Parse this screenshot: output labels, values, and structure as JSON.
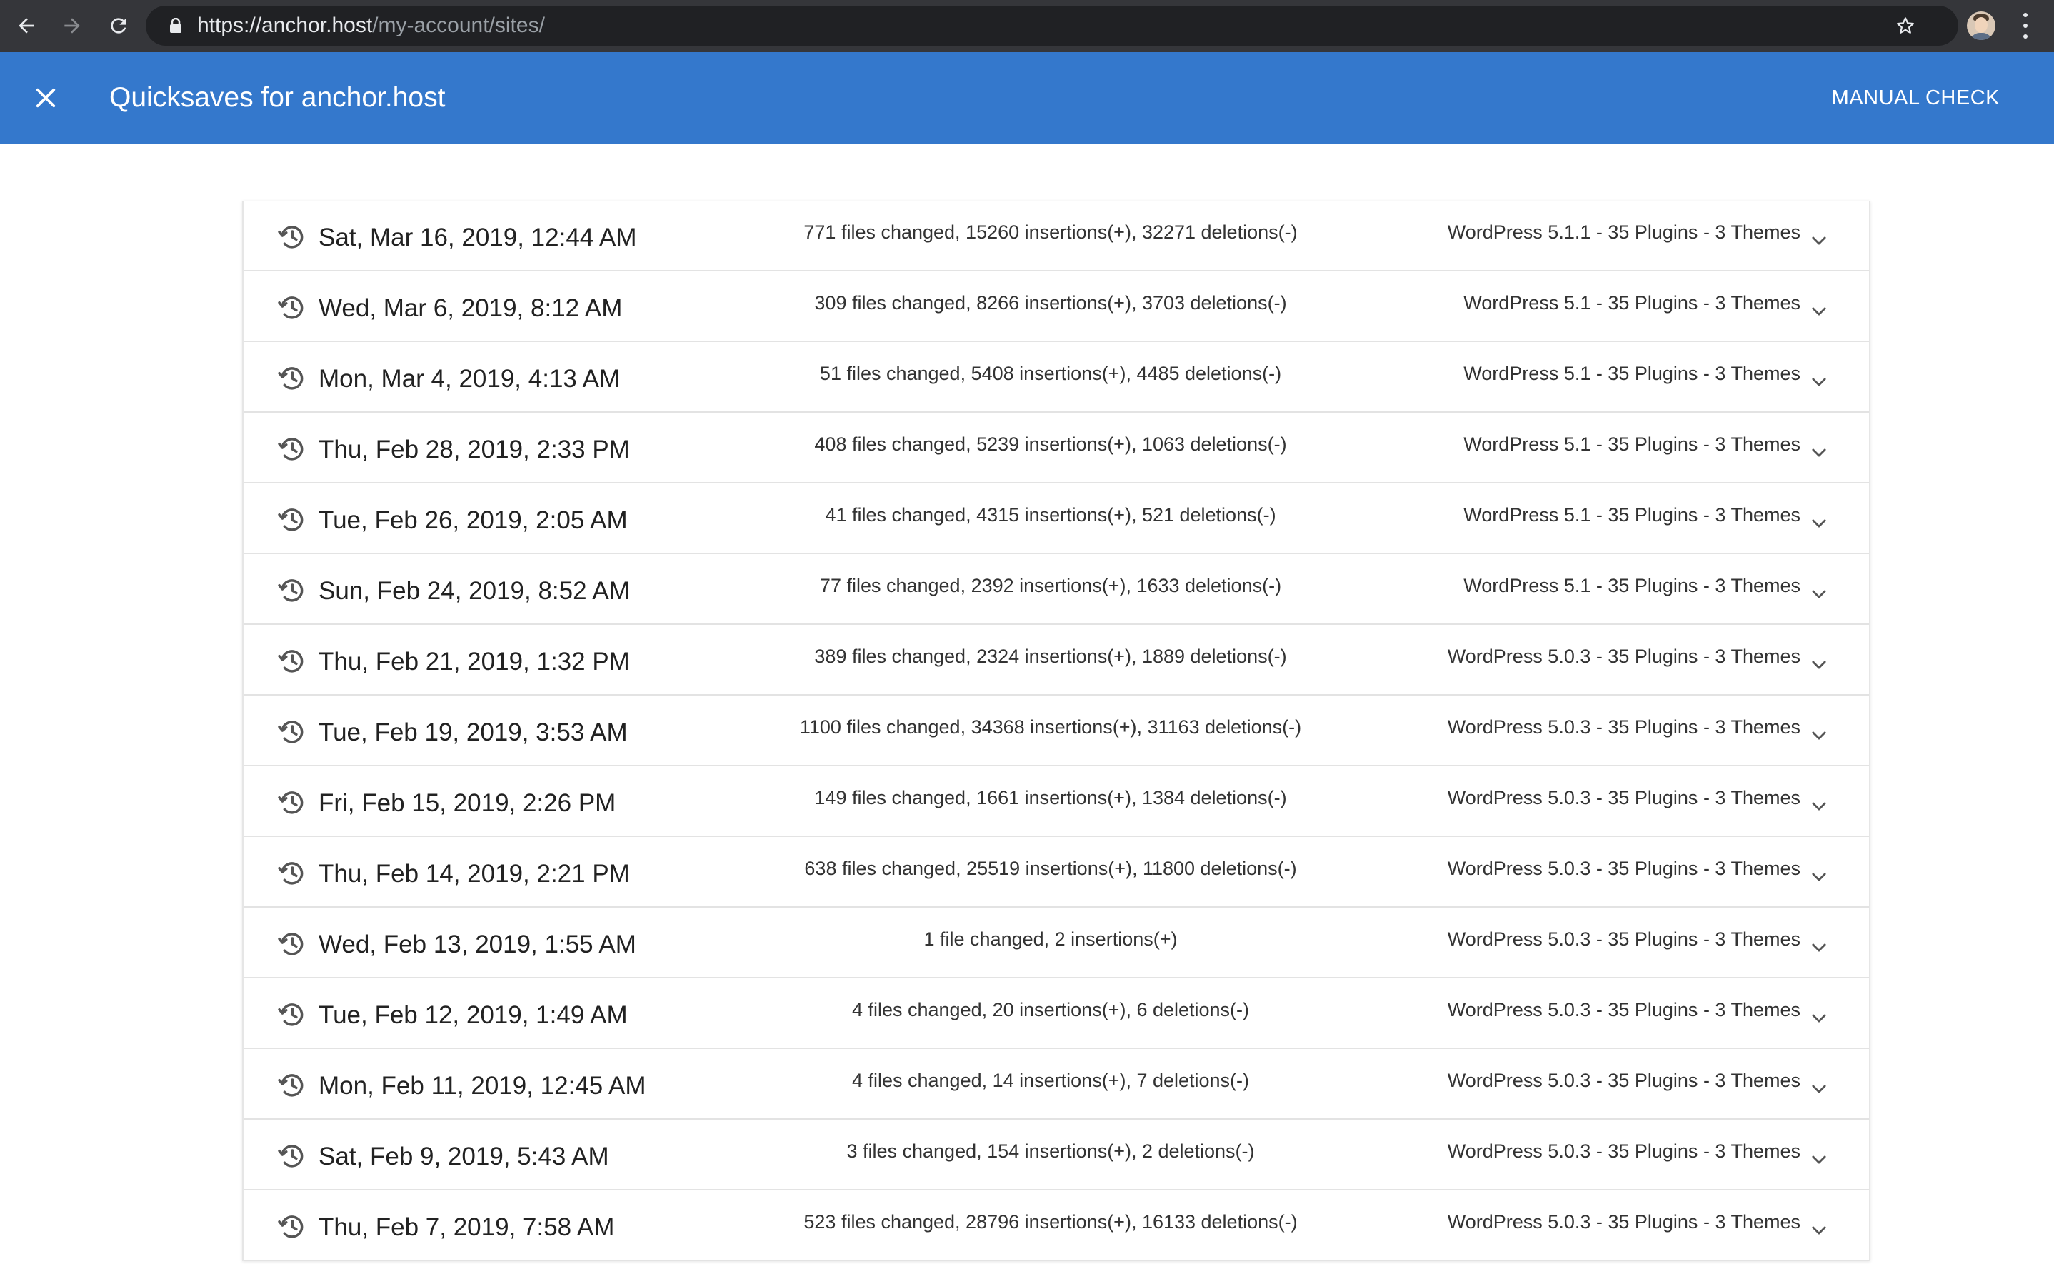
{
  "browser": {
    "url_host": "https://anchor.host",
    "url_path": "/my-account/sites/",
    "icons": {
      "back": "arrow-left-icon",
      "forward": "arrow-right-icon",
      "reload": "reload-icon",
      "lock": "lock-icon",
      "bookmark": "star-icon",
      "menu": "kebab-menu-icon"
    }
  },
  "header": {
    "title": "Quicksaves for anchor.host",
    "manual_check_label": "MANUAL CHECK",
    "background_color": "#3478cc",
    "close_icon": "close-icon"
  },
  "quicksaves": [
    {
      "date": "Sat, Mar 16, 2019, 12:44 AM",
      "changes": "771 files changed, 15260 insertions(+), 32271 deletions(-)",
      "summary": "WordPress 5.1.1 - 35 Plugins - 3 Themes"
    },
    {
      "date": "Wed, Mar 6, 2019, 8:12 AM",
      "changes": "309 files changed, 8266 insertions(+), 3703 deletions(-)",
      "summary": "WordPress 5.1 - 35 Plugins - 3 Themes"
    },
    {
      "date": "Mon, Mar 4, 2019, 4:13 AM",
      "changes": "51 files changed, 5408 insertions(+), 4485 deletions(-)",
      "summary": "WordPress 5.1 - 35 Plugins - 3 Themes"
    },
    {
      "date": "Thu, Feb 28, 2019, 2:33 PM",
      "changes": "408 files changed, 5239 insertions(+), 1063 deletions(-)",
      "summary": "WordPress 5.1 - 35 Plugins - 3 Themes"
    },
    {
      "date": "Tue, Feb 26, 2019, 2:05 AM",
      "changes": "41 files changed, 4315 insertions(+), 521 deletions(-)",
      "summary": "WordPress 5.1 - 35 Plugins - 3 Themes"
    },
    {
      "date": "Sun, Feb 24, 2019, 8:52 AM",
      "changes": "77 files changed, 2392 insertions(+), 1633 deletions(-)",
      "summary": "WordPress 5.1 - 35 Plugins - 3 Themes"
    },
    {
      "date": "Thu, Feb 21, 2019, 1:32 PM",
      "changes": "389 files changed, 2324 insertions(+), 1889 deletions(-)",
      "summary": "WordPress 5.0.3 - 35 Plugins - 3 Themes"
    },
    {
      "date": "Tue, Feb 19, 2019, 3:53 AM",
      "changes": "1100 files changed, 34368 insertions(+), 31163 deletions(-)",
      "summary": "WordPress 5.0.3 - 35 Plugins - 3 Themes"
    },
    {
      "date": "Fri, Feb 15, 2019, 2:26 PM",
      "changes": "149 files changed, 1661 insertions(+), 1384 deletions(-)",
      "summary": "WordPress 5.0.3 - 35 Plugins - 3 Themes"
    },
    {
      "date": "Thu, Feb 14, 2019, 2:21 PM",
      "changes": "638 files changed, 25519 insertions(+), 11800 deletions(-)",
      "summary": "WordPress 5.0.3 - 35 Plugins - 3 Themes"
    },
    {
      "date": "Wed, Feb 13, 2019, 1:55 AM",
      "changes": "1 file changed, 2 insertions(+)",
      "summary": "WordPress 5.0.3 - 35 Plugins - 3 Themes"
    },
    {
      "date": "Tue, Feb 12, 2019, 1:49 AM",
      "changes": "4 files changed, 20 insertions(+), 6 deletions(-)",
      "summary": "WordPress 5.0.3 - 35 Plugins - 3 Themes"
    },
    {
      "date": "Mon, Feb 11, 2019, 12:45 AM",
      "changes": "4 files changed, 14 insertions(+), 7 deletions(-)",
      "summary": "WordPress 5.0.3 - 35 Plugins - 3 Themes"
    },
    {
      "date": "Sat, Feb 9, 2019, 5:43 AM",
      "changes": "3 files changed, 154 insertions(+), 2 deletions(-)",
      "summary": "WordPress 5.0.3 - 35 Plugins - 3 Themes"
    },
    {
      "date": "Thu, Feb 7, 2019, 7:58 AM",
      "changes": "523 files changed, 28796 insertions(+), 16133 deletions(-)",
      "summary": "WordPress 5.0.3 - 35 Plugins - 3 Themes"
    }
  ],
  "row_icons": {
    "leading": "restore-icon",
    "trailing": "chevron-down-icon"
  }
}
